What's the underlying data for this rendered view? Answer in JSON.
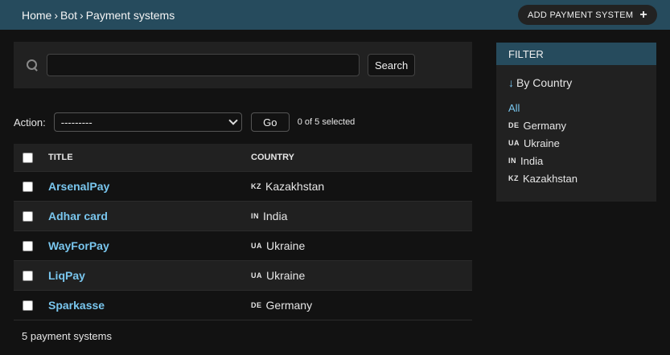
{
  "header": {
    "breadcrumb": [
      "Home",
      "Bot",
      "Payment systems"
    ],
    "separator": "›",
    "add_button": "ADD PAYMENT SYSTEM",
    "add_icon": "+"
  },
  "search": {
    "value": "",
    "placeholder": "",
    "button": "Search"
  },
  "actions": {
    "label": "Action:",
    "selected": "---------",
    "go": "Go",
    "count": "0 of 5 selected"
  },
  "table": {
    "columns": [
      "TITLE",
      "COUNTRY"
    ],
    "rows": [
      {
        "title": "ArsenalPay",
        "code": "KZ",
        "country": "Kazakhstan"
      },
      {
        "title": "Adhar card",
        "code": "IN",
        "country": "India"
      },
      {
        "title": "WayForPay",
        "code": "UA",
        "country": "Ukraine"
      },
      {
        "title": "LiqPay",
        "code": "UA",
        "country": "Ukraine"
      },
      {
        "title": "Sparkasse",
        "code": "DE",
        "country": "Germany"
      }
    ],
    "footer": "5 payment systems"
  },
  "filter": {
    "title": "FILTER",
    "by": "By Country",
    "arrow": "↓",
    "options": [
      {
        "code": "",
        "label": "All"
      },
      {
        "code": "DE",
        "label": "Germany"
      },
      {
        "code": "UA",
        "label": "Ukraine"
      },
      {
        "code": "IN",
        "label": "India"
      },
      {
        "code": "KZ",
        "label": "Kazakhstan"
      }
    ]
  },
  "colors": {
    "header_bg": "#264b5d",
    "link": "#79c6ee",
    "panel": "#212121",
    "page_bg": "#121212"
  }
}
